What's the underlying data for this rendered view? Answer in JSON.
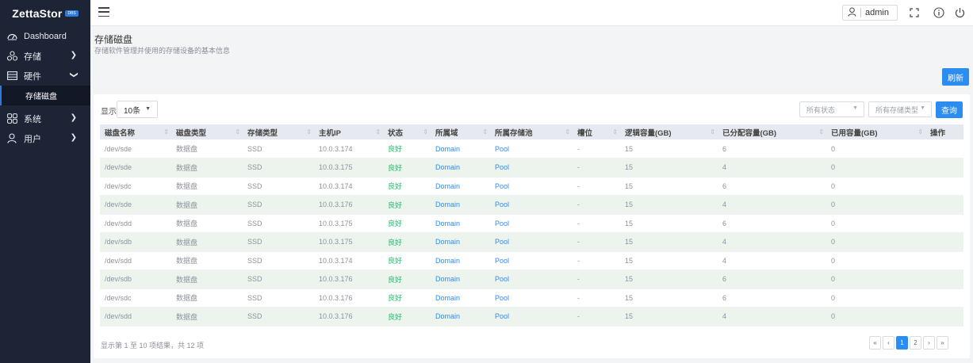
{
  "app": {
    "logo": "ZettaStor",
    "badge": "DBS"
  },
  "sidebar": {
    "items": [
      {
        "label": "Dashboard",
        "icon": "dashboard-icon"
      },
      {
        "label": "存储",
        "icon": "storage-icon",
        "chevron": "right"
      },
      {
        "label": "硬件",
        "icon": "hardware-icon",
        "chevron": "down"
      },
      {
        "label": "存储磁盘",
        "sub": true,
        "active": true
      },
      {
        "label": "系统",
        "icon": "system-icon",
        "chevron": "right"
      },
      {
        "label": "用户",
        "icon": "user-icon",
        "chevron": "right"
      }
    ]
  },
  "topbar": {
    "username": "admin"
  },
  "page": {
    "title": "存储磁盘",
    "description": "存储软件管理并使用的存储设备的基本信息",
    "refresh_label": "刷新"
  },
  "toolbar": {
    "show_label": "显示",
    "page_size": "10条",
    "status_filter": "所有状态",
    "type_filter": "所有存储类型",
    "query_label": "查询"
  },
  "table": {
    "columns": [
      "磁盘名称",
      "磁盘类型",
      "存储类型",
      "主机IP",
      "状态",
      "所属域",
      "所属存储池",
      "槽位",
      "逻辑容量(GB)",
      "已分配容量(GB)",
      "已用容量(GB)",
      "操作"
    ],
    "rows": [
      [
        "/dev/sde",
        "数据盘",
        "SSD",
        "10.0.3.174",
        "良好",
        "Domain",
        "Pool",
        "-",
        "15",
        "6",
        "0",
        ""
      ],
      [
        "/dev/sde",
        "数据盘",
        "SSD",
        "10.0.3.175",
        "良好",
        "Domain",
        "Pool",
        "-",
        "15",
        "4",
        "0",
        ""
      ],
      [
        "/dev/sdc",
        "数据盘",
        "SSD",
        "10.0.3.174",
        "良好",
        "Domain",
        "Pool",
        "-",
        "15",
        "6",
        "0",
        ""
      ],
      [
        "/dev/sde",
        "数据盘",
        "SSD",
        "10.0.3.176",
        "良好",
        "Domain",
        "Pool",
        "-",
        "15",
        "4",
        "0",
        ""
      ],
      [
        "/dev/sdd",
        "数据盘",
        "SSD",
        "10.0.3.175",
        "良好",
        "Domain",
        "Pool",
        "-",
        "15",
        "6",
        "0",
        ""
      ],
      [
        "/dev/sdb",
        "数据盘",
        "SSD",
        "10.0.3.175",
        "良好",
        "Domain",
        "Pool",
        "-",
        "15",
        "4",
        "0",
        ""
      ],
      [
        "/dev/sdd",
        "数据盘",
        "SSD",
        "10.0.3.174",
        "良好",
        "Domain",
        "Pool",
        "-",
        "15",
        "4",
        "0",
        ""
      ],
      [
        "/dev/sdb",
        "数据盘",
        "SSD",
        "10.0.3.176",
        "良好",
        "Domain",
        "Pool",
        "-",
        "15",
        "6",
        "0",
        ""
      ],
      [
        "/dev/sdc",
        "数据盘",
        "SSD",
        "10.0.3.176",
        "良好",
        "Domain",
        "Pool",
        "-",
        "15",
        "6",
        "0",
        ""
      ],
      [
        "/dev/sdd",
        "数据盘",
        "SSD",
        "10.0.3.176",
        "良好",
        "Domain",
        "Pool",
        "-",
        "15",
        "4",
        "0",
        ""
      ]
    ]
  },
  "footer": {
    "summary": "显示第 1 至 10 项结果，共 12 项",
    "pages": [
      "«",
      "‹",
      "1",
      "2",
      "›",
      "»"
    ],
    "current_page": "1"
  },
  "colors": {
    "sidebar_bg": "#1d2435",
    "accent": "#2d8cf0",
    "good": "#19be6b"
  }
}
